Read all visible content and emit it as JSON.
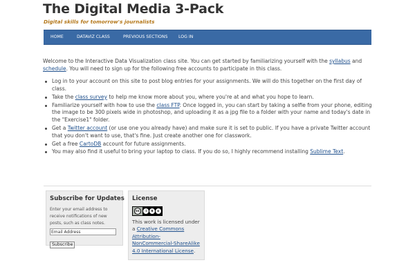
{
  "site": {
    "title": "The Digital Media 3-Pack",
    "tagline": "Digital skills for tomorrow's journalists"
  },
  "nav": {
    "items": [
      {
        "label": "HOME"
      },
      {
        "label": "DATAVIZ CLASS"
      },
      {
        "label": "PREVIOUS SECTIONS"
      },
      {
        "label": "LOG IN"
      }
    ]
  },
  "content": {
    "intro": {
      "before": "Welcome to the Interactive Data Visualization class site. You can get started by familiarizing yourself with the ",
      "link1": "syllabus",
      "middle": " and ",
      "link2": "schedule",
      "after": ". You will need to sign up for the following free accounts to participate in this class."
    },
    "bullets": {
      "b1": "Log in to your account on this site to post blog entries for your assignments. We will do this together on the first day of class.",
      "b2_before": "Take the ",
      "b2_link": "class survey",
      "b2_after": " to help me know more about you, where you're at and what you hope to learn.",
      "b3_before": "Familiarize yourself with how to use the ",
      "b3_link": "class FTP",
      "b3_after": ". Once logged in, you can start by taking a selfie from your phone, editing the image to be 300 pixels wide in photoshop, and uploading it as a jpg file to a folder with your name and today's date in the \"Exercise1\" folder.",
      "b4_before": "Get a ",
      "b4_link": "Twitter account",
      "b4_after": " (or use one you already have) and make sure it is set to public. If you have a private Twitter account that you don't want to use, that's fine. Just create another one for classwork.",
      "b5_before": "Get a free ",
      "b5_link": "CartoDB",
      "b5_after": " account for future assignments.",
      "b6_before": "You may also find it useful to bring your laptop to class. If you do so, I highly recommend installing ",
      "b6_link": "Sublime Text",
      "b6_after": "."
    }
  },
  "subscribe_widget": {
    "title": "Subscribe for Updates",
    "description": "Enter your email address to receive notifications of new posts, such as class notes.",
    "email_placeholder": "Email Address",
    "button_label": "Subscribe"
  },
  "license_widget": {
    "title": "License",
    "badge_icon": "cc-by-nc-sa-badge",
    "text_before": "This work is licensed under a ",
    "link": "Creative Commons Attribution-NonCommercial-ShareAlike 4.0 International License",
    "text_after": "."
  },
  "colors": {
    "nav_background": "#3a6aa5",
    "tagline": "#b5791c",
    "link": "#1e4f8c"
  }
}
